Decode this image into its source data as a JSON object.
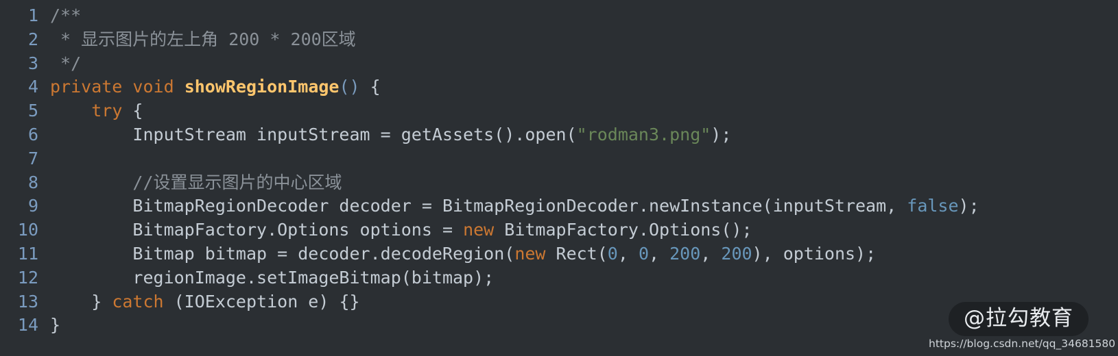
{
  "editor": {
    "background_color": "#2b2f33",
    "gutter_color": "#7b9cc0",
    "default_text_color": "#c4ccd4",
    "language": "java",
    "total_lines": 14
  },
  "palette": {
    "comment": "#8b9299",
    "keyword": "#cc7832",
    "function_name": "#ffc66d",
    "string": "#6a8759",
    "number": "#6897bb",
    "constant": "#6897bb",
    "punctuation": "#7a9bbd",
    "plain": "#c4ccd4"
  },
  "lines": [
    {
      "number": "1",
      "tokens": [
        {
          "text": "/**",
          "type": "comment"
        }
      ]
    },
    {
      "number": "2",
      "tokens": [
        {
          "text": " * 显示图片的左上角 200 * 200区域",
          "type": "comment"
        }
      ]
    },
    {
      "number": "3",
      "tokens": [
        {
          "text": " */",
          "type": "comment"
        }
      ]
    },
    {
      "number": "4",
      "tokens": [
        {
          "text": "private",
          "type": "keyword"
        },
        {
          "text": " ",
          "type": "plain"
        },
        {
          "text": "void",
          "type": "keyword"
        },
        {
          "text": " ",
          "type": "plain"
        },
        {
          "text": "showRegionImage",
          "type": "fname"
        },
        {
          "text": "()",
          "type": "punct"
        },
        {
          "text": " {",
          "type": "plain"
        }
      ]
    },
    {
      "number": "5",
      "tokens": [
        {
          "text": "    ",
          "type": "plain"
        },
        {
          "text": "try",
          "type": "keyword"
        },
        {
          "text": " {",
          "type": "plain"
        }
      ]
    },
    {
      "number": "6",
      "tokens": [
        {
          "text": "        InputStream inputStream = getAssets().open(",
          "type": "plain"
        },
        {
          "text": "\"rodman3.png\"",
          "type": "string"
        },
        {
          "text": ");",
          "type": "plain"
        }
      ]
    },
    {
      "number": "7",
      "tokens": []
    },
    {
      "number": "8",
      "tokens": [
        {
          "text": "        ",
          "type": "plain"
        },
        {
          "text": "//设置显示图片的中心区域",
          "type": "comment"
        }
      ]
    },
    {
      "number": "9",
      "tokens": [
        {
          "text": "        BitmapRegionDecoder decoder = BitmapRegionDecoder.newInstance(inputStream, ",
          "type": "plain"
        },
        {
          "text": "false",
          "type": "const"
        },
        {
          "text": ");",
          "type": "plain"
        }
      ]
    },
    {
      "number": "10",
      "tokens": [
        {
          "text": "        BitmapFactory.Options options = ",
          "type": "plain"
        },
        {
          "text": "new",
          "type": "keyword"
        },
        {
          "text": " BitmapFactory.Options();",
          "type": "plain"
        }
      ]
    },
    {
      "number": "11",
      "tokens": [
        {
          "text": "        Bitmap bitmap = decoder.decodeRegion(",
          "type": "plain"
        },
        {
          "text": "new",
          "type": "keyword"
        },
        {
          "text": " Rect(",
          "type": "plain"
        },
        {
          "text": "0",
          "type": "number"
        },
        {
          "text": ", ",
          "type": "plain"
        },
        {
          "text": "0",
          "type": "number"
        },
        {
          "text": ", ",
          "type": "plain"
        },
        {
          "text": "200",
          "type": "number"
        },
        {
          "text": ", ",
          "type": "plain"
        },
        {
          "text": "200",
          "type": "number"
        },
        {
          "text": "), options);",
          "type": "plain"
        }
      ]
    },
    {
      "number": "12",
      "tokens": [
        {
          "text": "        regionImage.setImageBitmap(bitmap);",
          "type": "plain"
        }
      ]
    },
    {
      "number": "13",
      "tokens": [
        {
          "text": "    } ",
          "type": "plain"
        },
        {
          "text": "catch",
          "type": "keyword"
        },
        {
          "text": " (IOException e) {}",
          "type": "plain"
        }
      ]
    },
    {
      "number": "14",
      "tokens": [
        {
          "text": "}",
          "type": "plain"
        }
      ]
    }
  ],
  "watermark": {
    "handle": "@拉勾教育",
    "url": "https://blog.csdn.net/qq_34681580"
  }
}
